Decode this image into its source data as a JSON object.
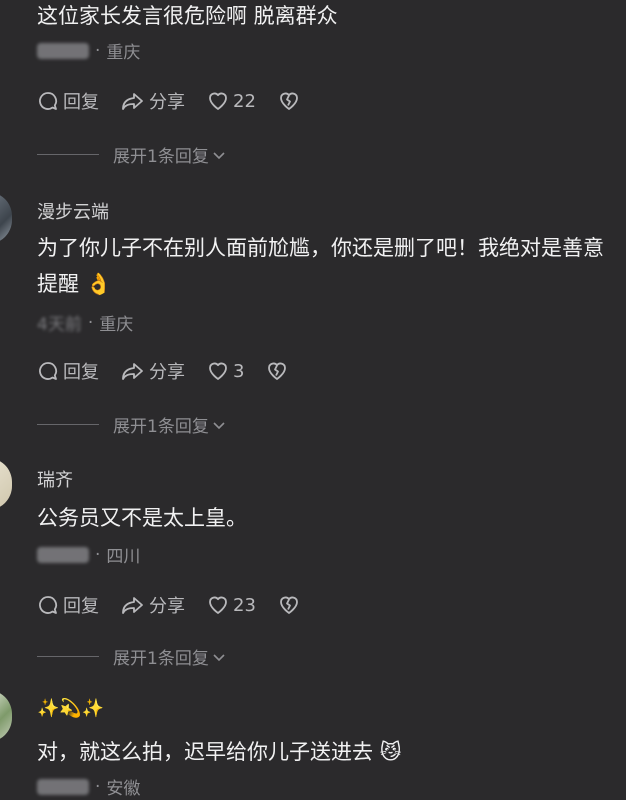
{
  "comments": [
    {
      "name": "",
      "text": "这位家长发言很危险啊 脱离群众",
      "location": "重庆",
      "reply_label": "回复",
      "share_label": "分享",
      "likes": "22",
      "expand_label": "展开1条回复"
    },
    {
      "name": "漫步云端",
      "text": "为了你儿子不在别人面前尬尴，你还是删了吧！我绝对是善意提醒 👌",
      "time": "4天前",
      "location": "重庆",
      "reply_label": "回复",
      "share_label": "分享",
      "likes": "3",
      "expand_label": "展开1条回复"
    },
    {
      "name": "瑞齐",
      "text": "公务员又不是太上皇。",
      "location": "四川",
      "reply_label": "回复",
      "share_label": "分享",
      "likes": "23",
      "expand_label": "展开1条回复"
    },
    {
      "name": "✨💫✨",
      "text": "对，就这么拍，迟早给你儿子送进去 😼",
      "location": "安徽"
    }
  ],
  "colors": {
    "background": "#2b2a2c",
    "text": "#f1f1f2",
    "muted": "#8f8f93",
    "action": "#b9b9bc"
  }
}
